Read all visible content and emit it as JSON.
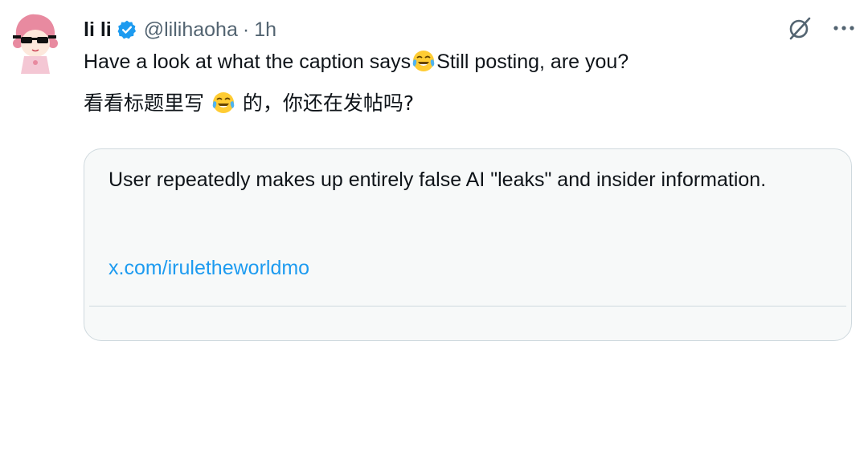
{
  "post": {
    "author_name": "li li",
    "handle": "@lilihaoha",
    "separator": "·",
    "time": "1h",
    "text_en_before": "Have a look at what the caption says",
    "text_en_after": "Still posting, are you?",
    "text_zh_before": "看看标题里写 ",
    "text_zh_after": " 的，你还在发帖吗?",
    "emoji": "face-with-tears-of-joy"
  },
  "community_note": {
    "text": "User repeatedly makes up entirely false AI \"leaks\" and insider information.",
    "link": "x.com/iruletheworldmo"
  },
  "icons": {
    "verified": "verified-badge-icon",
    "grok": "grok-icon",
    "more": "more-options-icon"
  },
  "colors": {
    "accent": "#1d9bf0",
    "secondary_text": "#536471",
    "card_border": "#cfd9de",
    "card_bg": "#f7f9f9"
  }
}
